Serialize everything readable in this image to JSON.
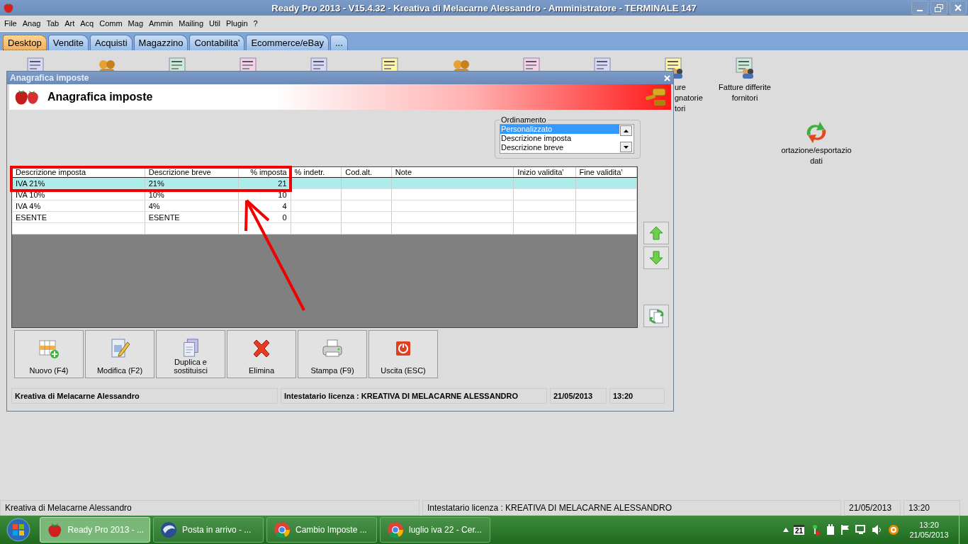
{
  "window": {
    "title": "Ready Pro 2013 - V15.4.32 - Kreativa di Melacarne Alessandro - Amministratore - TERMINALE 147"
  },
  "menu": [
    "File",
    "Anag",
    "Tab",
    "Art",
    "Acq",
    "Comm",
    "Mag",
    "Ammin",
    "Mailing",
    "Util",
    "Plugin",
    "?"
  ],
  "tabs": [
    {
      "label": "Desktop",
      "selected": true
    },
    {
      "label": "Vendite",
      "selected": false
    },
    {
      "label": "Acquisti",
      "selected": false
    },
    {
      "label": "Magazzino",
      "selected": false
    },
    {
      "label": "Contabilita'",
      "selected": false
    },
    {
      "label": "Ecommerce/eBay",
      "selected": false
    },
    {
      "label": "...",
      "selected": false
    }
  ],
  "desktop_icons": [
    {
      "kind": "doc"
    },
    {
      "kind": "people"
    },
    {
      "kind": "doc"
    },
    {
      "kind": "doc"
    },
    {
      "kind": "doc"
    },
    {
      "kind": "doc"
    },
    {
      "kind": "people"
    },
    {
      "kind": "doc"
    },
    {
      "kind": "doc"
    },
    {
      "kind": "docpeople",
      "clipped": true,
      "lines": [
        "ure",
        "gnatorie",
        "tori"
      ]
    },
    {
      "kind": "docpeople",
      "clipped": false,
      "lines": [
        "Fatture differite",
        "fornitori"
      ]
    }
  ],
  "desktop_side": {
    "lines": [
      "ortazione/esportazio",
      "dati"
    ]
  },
  "dialog": {
    "title": "Anagrafica imposte",
    "header": "Anagrafica imposte",
    "ordering": {
      "label": "Ordinamento",
      "options": [
        {
          "label": "Personalizzato",
          "selected": true
        },
        {
          "label": "Descrizione imposta",
          "selected": false
        },
        {
          "label": "Descrizione breve",
          "selected": false
        }
      ]
    },
    "table": {
      "columns": [
        "Descrizione imposta",
        "Descrizione breve",
        "% imposta",
        "% indetr.",
        "Cod.alt.",
        "Note",
        "Inizio validita'",
        "Fine validita'"
      ],
      "rows": [
        {
          "cells": [
            "IVA 21%",
            "21%",
            "21",
            "",
            "",
            "",
            "",
            ""
          ],
          "selected": true
        },
        {
          "cells": [
            "IVA 10%",
            "10%",
            "10",
            "",
            "",
            "",
            "",
            ""
          ],
          "selected": false
        },
        {
          "cells": [
            "IVA 4%",
            "4%",
            "4",
            "",
            "",
            "",
            "",
            ""
          ],
          "selected": false
        },
        {
          "cells": [
            "ESENTE",
            "ESENTE",
            "0",
            "",
            "",
            "",
            "",
            ""
          ],
          "selected": false
        },
        {
          "cells": [
            "",
            "",
            "",
            "",
            "",
            "",
            "",
            ""
          ],
          "selected": false
        }
      ]
    },
    "buttons": [
      {
        "kind": "new",
        "lines": [
          "Nuovo (F4)"
        ]
      },
      {
        "kind": "edit",
        "lines": [
          "Modifica (F2)"
        ]
      },
      {
        "kind": "copy",
        "lines": [
          "Duplica e",
          "sostituisci"
        ]
      },
      {
        "kind": "delete",
        "lines": [
          "Elimina"
        ]
      },
      {
        "kind": "print",
        "lines": [
          "Stampa (F9)"
        ]
      },
      {
        "kind": "exit",
        "lines": [
          "Uscita (ESC)"
        ]
      }
    ],
    "status_bar": [
      "Kreativa di Melacarne Alessandro",
      "Intestatario licenza : KREATIVA DI MELACARNE ALESSANDRO",
      "21/05/2013",
      "13:20"
    ]
  },
  "status_bar": [
    "Kreativa di Melacarne Alessandro",
    "Intestatario licenza : KREATIVA DI MELACARNE ALESSANDRO",
    "21/05/2013",
    "13:20"
  ],
  "taskbar": {
    "tasks": [
      {
        "kind": "berry",
        "label": "Ready Pro 2013 - ...",
        "selected": true
      },
      {
        "kind": "mail",
        "label": "Posta in arrivo - ...",
        "selected": false
      },
      {
        "kind": "chrome",
        "label": "Cambio Imposte ...",
        "selected": false
      },
      {
        "kind": "chrome",
        "label": "luglio iva 22 - Cer...",
        "selected": false
      }
    ],
    "calendar_day": "21",
    "time": "13:20",
    "date": "21/05/2013"
  }
}
